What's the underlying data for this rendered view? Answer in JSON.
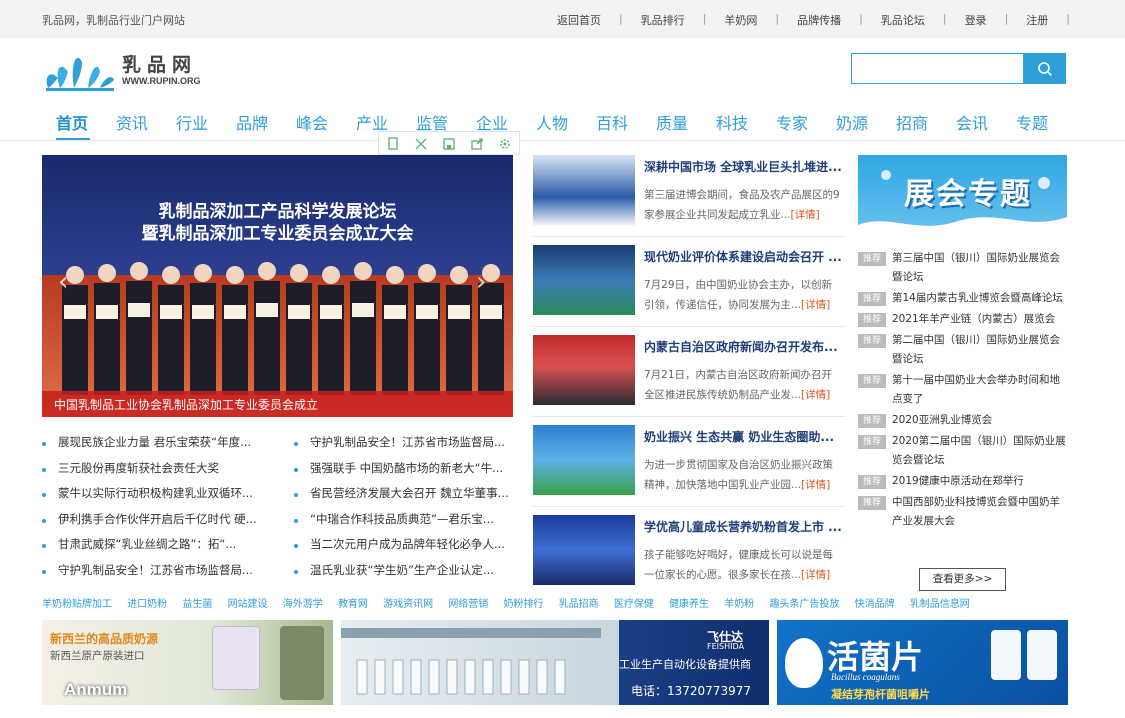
{
  "topbar": {
    "slogan": "乳品网，乳制品行业门户网站",
    "links": [
      "返回首页",
      "乳品排行",
      "羊奶网",
      "品牌传播",
      "乳品论坛",
      "登录",
      "注册"
    ]
  },
  "logo": {
    "cn": "乳品网",
    "en": "WWW.RUPIN.ORG"
  },
  "search": {
    "placeholder": ""
  },
  "nav": [
    "首页",
    "资讯",
    "行业",
    "品牌",
    "峰会",
    "产业",
    "监管",
    "企业",
    "人物",
    "百科",
    "质量",
    "科技",
    "专家",
    "奶源",
    "招商",
    "会讯",
    "专题"
  ],
  "slider": {
    "photo_line1": "乳制品深加工产品科学发展论坛",
    "photo_line2": "暨乳制品深加工专业委员会成立大会",
    "caption": "中国乳制品工业协会乳制品深加工专业委员会成立"
  },
  "news_left": [
    "展现民族企业力量 君乐宝荣获“年度...",
    "三元股份再度斩获社会责任大奖",
    "蒙牛以实际行动积极构建乳业双循环...",
    "伊利携手合作伙伴开启后千亿时代 硬...",
    "甘肃武威探“乳业丝绸之路”：拓“...",
    "守护乳制品安全！江苏省市场监督局..."
  ],
  "news_right": [
    "守护乳制品安全！江苏省市场监督局...",
    "强强联手 中国奶酪市场的新老大“牛...",
    "省民营经济发展大会召开 魏立华董事...",
    "“中瑞合作科技品质典范”—君乐宝...",
    "当二次元用户成为品牌年轻化必争人...",
    "温氏乳业获“学生奶”生产企业认定..."
  ],
  "featured": [
    {
      "title": "深耕中国市场 全球乳业巨头扎堆进...",
      "desc": "第三届进博会期间，食品及农产品展区的9家参展企业共同发起成立乳业...",
      "more": "[详情]"
    },
    {
      "title": "现代奶业评价体系建设启动会召开 ...",
      "desc": "7月29日，由中国奶业协会主办，以创新引领，传递信任，协同发展为主...",
      "more": "[详情]"
    },
    {
      "title": "内蒙古自治区政府新闻办召开发布...",
      "desc": "7月21日，内蒙古自治区政府新闻办召开全区推进民族传统奶制品产业发...",
      "more": "[详情]"
    },
    {
      "title": "奶业振兴 生态共赢 奶业生态圈助...",
      "desc": "为进一步贯彻国家及自治区奶业振兴政策精神，加快落地中国乳业产业园...",
      "more": "[详情]"
    },
    {
      "title": "学优高儿童成长营养奶粉首发上市 ...",
      "desc": "孩子能够吃好喝好，健康成长可以说是每一位家长的心愿。很多家长在孩...",
      "more": "[详情]"
    }
  ],
  "expo": {
    "banner": "展会专题",
    "tag": "推荐",
    "items": [
      "第三届中国（银川）国际奶业展览会暨论坛",
      "第14届内蒙古乳业博览会暨高峰论坛",
      "2021年羊产业链（内蒙古）展览会",
      "第二届中国（银川）国际奶业展览会暨论坛",
      "第十一届中国奶业大会举办时间和地点变了",
      "2020亚洲乳业博览会",
      "2020第二届中国（银川）国际奶业展览会暨论坛",
      "2019健康中原活动在郑举行",
      "中国西部奶业科技博览会暨中国奶羊产业发展大会"
    ],
    "more": "查看更多>>"
  },
  "friend_links": [
    "羊奶粉贴牌加工",
    "进口奶粉",
    "益生菌",
    "网站建设",
    "海外游学",
    "教育网",
    "游戏资讯网",
    "网络营销",
    "奶粉排行",
    "乳品招商",
    "医疗保健",
    "健康养生",
    "羊奶粉",
    "趣头条广告投放",
    "快消品牌",
    "乳制品信息网"
  ],
  "ads": {
    "ad1_line1": "新西兰的高品质奶源",
    "ad1_line2": "新西兰原产原装进口",
    "ad1_brand": "Anmum",
    "ad2_brand": "飞仕达",
    "ad2_brand_en": "FEISHIDA",
    "ad2_line1": "工业生产自动化设备提供商",
    "ad2_line2": "电话：13720773977",
    "ad3_title": "活菌片",
    "ad3_en": "Bacillus coagulans",
    "ad3_sub": "凝结芽孢杆菌咀嚼片"
  },
  "colors": {
    "accent": "#2f9fd8",
    "more": "#e5541c",
    "caption_bg": "#c81e1e"
  }
}
